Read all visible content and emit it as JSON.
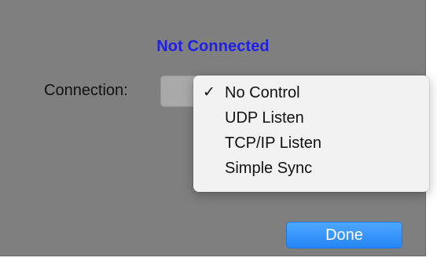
{
  "dialog": {
    "status_title": "Not Connected",
    "connection_label": "Connection:",
    "done_label": "Done",
    "colors": {
      "status_title": "#1f1fe6",
      "sheet_background": "#7f7f7f",
      "menu_background": "#f2f2f2",
      "done_button": "#2486f6"
    }
  },
  "connection_menu": {
    "selected": "No Control",
    "check_glyph": "✓",
    "items": [
      {
        "label": "No Control",
        "checked": true
      },
      {
        "label": "UDP Listen",
        "checked": false
      },
      {
        "label": "TCP/IP Listen",
        "checked": false
      },
      {
        "label": "Simple Sync",
        "checked": false
      }
    ]
  }
}
